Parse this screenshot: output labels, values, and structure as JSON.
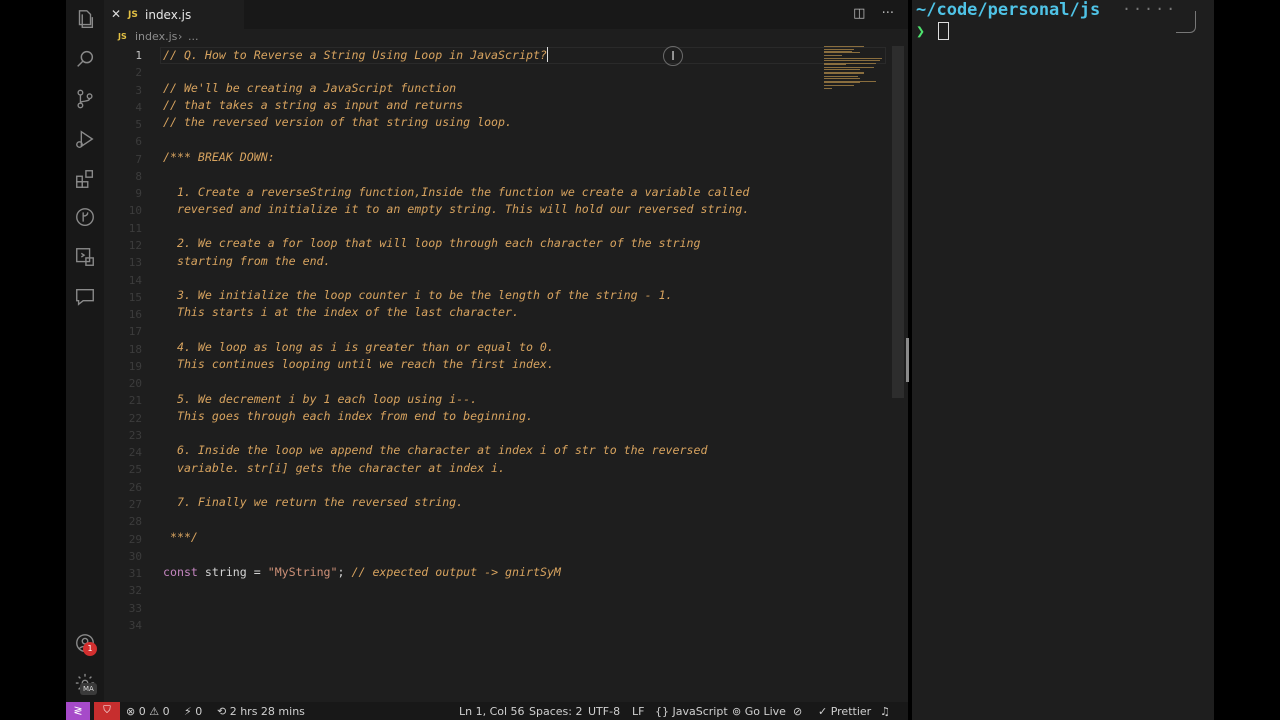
{
  "tab": {
    "close": "✕",
    "file_type": "JS",
    "file_name": "index.js",
    "split_icon": "split-editor-icon",
    "more_icon": "more-icon"
  },
  "breadcrumb": {
    "file_type": "JS",
    "file": "index.js",
    "separator": "›",
    "more": "..."
  },
  "line_numbers": [
    "1",
    "2",
    "3",
    "4",
    "5",
    "6",
    "7",
    "8",
    "9",
    "10",
    "11",
    "12",
    "13",
    "14",
    "15",
    "16",
    "17",
    "18",
    "19",
    "20",
    "21",
    "22",
    "23",
    "24",
    "25",
    "26",
    "27",
    "28",
    "29",
    "30",
    "31",
    "32",
    "33",
    "34"
  ],
  "code": {
    "l1": "// Q. How to Reverse a String Using Loop in JavaScript?",
    "l3": "// We'll be creating a JavaScript function",
    "l4": "// that takes a string as input and returns",
    "l5": "// the reversed version of that string using loop.",
    "l7": "/*** BREAK DOWN:",
    "l9": "  1. Create a reverseString function,Inside the function we create a variable called",
    "l10": "  reversed and initialize it to an empty string. This will hold our reversed string.",
    "l12": "  2. We create a for loop that will loop through each character of the string",
    "l13": "  starting from the end.",
    "l15": "  3. We initialize the loop counter i to be the length of the string - 1.",
    "l16": "  This starts i at the index of the last character.",
    "l18": "  4. We loop as long as i is greater than or equal to 0.",
    "l19": "  This continues looping until we reach the first index.",
    "l21": "  5. We decrement i by 1 each loop using i--.",
    "l22": "  This goes through each index from end to beginning.",
    "l24": "  6. Inside the loop we append the character at index i of str to the reversed",
    "l25": "  variable. str[i] gets the character at index i.",
    "l27": "  7. Finally we return the reversed string.",
    "l29": " ***/",
    "l31_kw": "const",
    "l31_id": " string = ",
    "l31_str": "\"MyString\"",
    "l31_semi": "; ",
    "l31_cmt": "// expected output -> gnirtSyM"
  },
  "activity_icons": [
    "explorer-icon",
    "search-icon",
    "source-control-icon",
    "run-debug-icon",
    "extensions-icon",
    "git-graph-icon",
    "remote-explorer-icon",
    "comments-icon",
    "account-icon",
    "settings-gear-icon"
  ],
  "activity_badges": {
    "account": "1",
    "settings": "MA"
  },
  "statusbar": {
    "remote": "≷",
    "shield": "⛉",
    "problems": "⊗ 0 ⚠ 0",
    "ports": "⚡ 0",
    "time": "⟲ 2 hrs 28 mins",
    "position": "Ln 1, Col 56",
    "spaces": "Spaces: 2",
    "encoding": "UTF-8",
    "eol": "LF",
    "language": "{} JavaScript",
    "go_live": "Go Live",
    "prettier": "✓ Prettier",
    "bell": "🔔"
  },
  "terminal": {
    "path": "~/code/personal/js",
    "dots": "·····",
    "prompt": "❯"
  },
  "colors": {
    "comment": "#d7a35f",
    "keyword": "#c586c0",
    "string": "#ce9178",
    "terminal_path": "#4fc3e6",
    "prompt": "#4ee36e",
    "remote_bg": "#a64ac9",
    "shield_bg": "#c72e2e"
  }
}
